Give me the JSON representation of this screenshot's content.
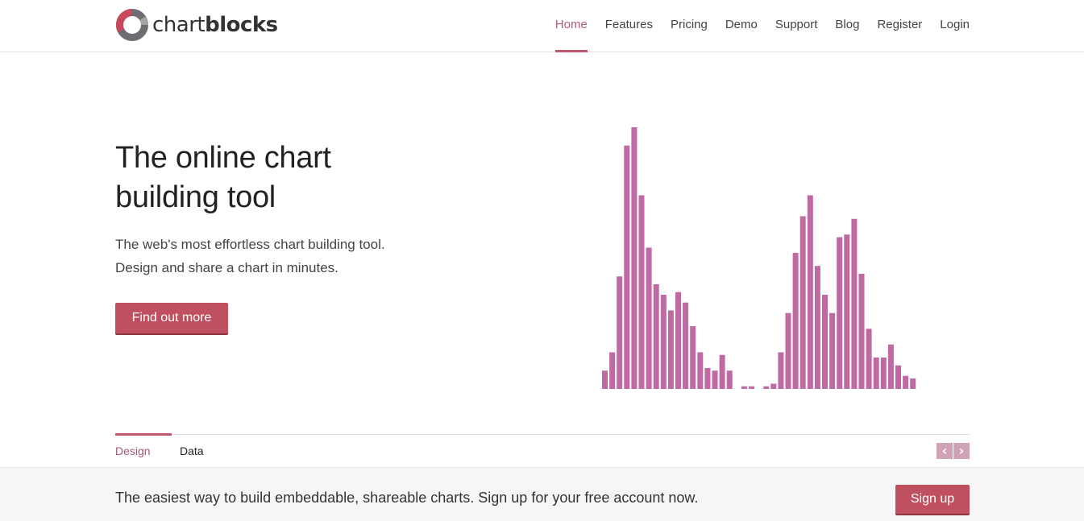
{
  "brand": {
    "name_light": "chart",
    "name_bold": "blocks",
    "accent": "#c0505f",
    "bar_color": "#c06aa3"
  },
  "nav": {
    "items": [
      {
        "label": "Home",
        "active": true
      },
      {
        "label": "Features"
      },
      {
        "label": "Pricing"
      },
      {
        "label": "Demo"
      },
      {
        "label": "Support"
      },
      {
        "label": "Blog"
      },
      {
        "label": "Register"
      },
      {
        "label": "Login"
      }
    ]
  },
  "hero": {
    "title_line1": "The online chart",
    "title_line2": "building tool",
    "subtitle_line1": "The web's most effortless chart building tool.",
    "subtitle_line2": "Design and share a chart in minutes.",
    "cta_label": "Find out more"
  },
  "chart_data": {
    "type": "bar",
    "values": [
      7,
      14,
      43,
      93,
      100,
      74,
      54,
      40,
      36,
      30,
      37,
      33,
      24,
      14,
      8,
      7,
      13,
      7,
      0,
      1,
      1,
      0,
      1,
      2,
      14,
      29,
      52,
      66,
      74,
      47,
      36,
      29,
      58,
      59,
      65,
      44,
      23,
      12,
      12,
      17,
      9,
      5,
      4
    ],
    "ylim": [
      0,
      100
    ],
    "grid": false
  },
  "tabs": {
    "design_label": "Design",
    "data_label": "Data",
    "prev_icon": "chevron-left-icon",
    "next_icon": "chevron-right-icon"
  },
  "band": {
    "text": "The easiest way to build embeddable, shareable charts. Sign up for your free account now.",
    "signup_label": "Sign up"
  }
}
